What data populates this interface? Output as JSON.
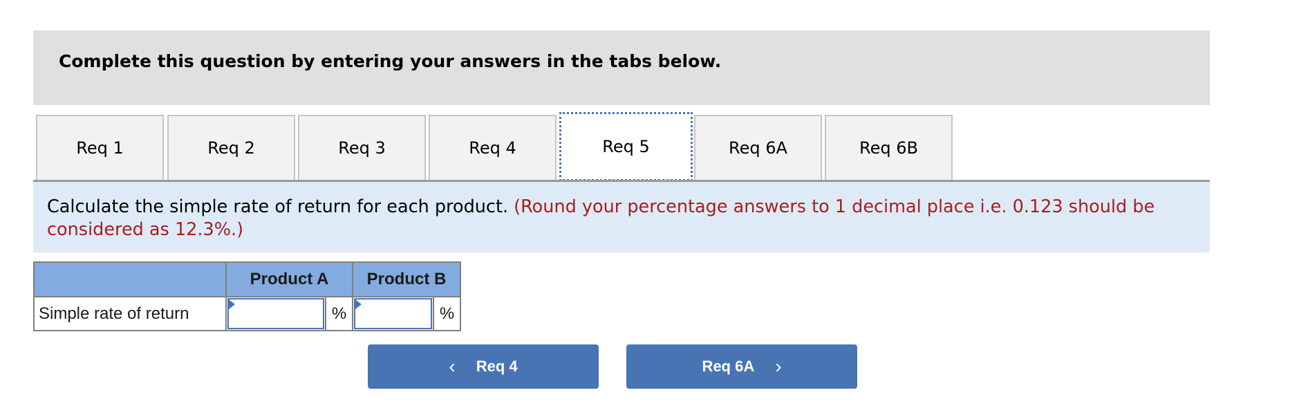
{
  "header": {
    "title": "Complete this question by entering your answers in the tabs below."
  },
  "tabs": [
    {
      "label": "Req 1",
      "active": false
    },
    {
      "label": "Req 2",
      "active": false
    },
    {
      "label": "Req 3",
      "active": false
    },
    {
      "label": "Req 4",
      "active": false
    },
    {
      "label": "Req 5",
      "active": true
    },
    {
      "label": "Req 6A",
      "active": false
    },
    {
      "label": "Req 6B",
      "active": false
    }
  ],
  "instructions": {
    "text": "Calculate the simple rate of return for each product.",
    "hint": "(Round your percentage answers to 1 decimal place i.e. 0.123 should be considered as 12.3%.)"
  },
  "table": {
    "columns": [
      "",
      "Product A",
      "Product B"
    ],
    "rows": [
      {
        "label": "Simple rate of return",
        "product_a": "",
        "product_b": "",
        "unit": "%"
      }
    ]
  },
  "navigation": {
    "prev_label": "Req 4",
    "next_label": "Req 6A",
    "prev_icon": "chevron-left-icon",
    "next_icon": "chevron-right-icon"
  },
  "colors": {
    "header_bg": "#e0e0e0",
    "info_bg": "#deebf7",
    "hint_text": "#a61e1e",
    "table_header_bg": "#84abdf",
    "button_bg": "#4874b4",
    "active_tab_outline": "#4a72b8"
  }
}
